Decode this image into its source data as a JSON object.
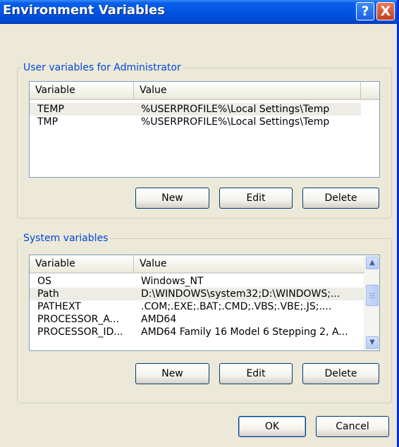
{
  "window": {
    "title": "Environment Variables",
    "help_label": "?",
    "close_label": "X",
    "title_bar_color": "#0055E5"
  },
  "user_vars": {
    "group_label": "User variables for Administrator",
    "columns": [
      "Variable",
      "Value"
    ],
    "rows": [
      {
        "variable": "TEMP",
        "value": "%USERPROFILE%\\Local Settings\\Temp"
      },
      {
        "variable": "TMP",
        "value": "%USERPROFILE%\\Local Settings\\Temp"
      }
    ],
    "selected_index": 0,
    "buttons": {
      "new": "New",
      "edit": "Edit",
      "delete": "Delete"
    }
  },
  "system_vars": {
    "group_label": "System variables",
    "columns": [
      "Variable",
      "Value"
    ],
    "rows": [
      {
        "variable": "OS",
        "value": "Windows_NT"
      },
      {
        "variable": "Path",
        "value": "D:\\WINDOWS\\system32;D:\\WINDOWS;..."
      },
      {
        "variable": "PATHEXT",
        "value": ".COM;.EXE;.BAT;.CMD;.VBS;.VBE;.JS;...."
      },
      {
        "variable": "PROCESSOR_A...",
        "value": "AMD64"
      },
      {
        "variable": "PROCESSOR_ID...",
        "value": "AMD64 Family 16 Model 6 Stepping 2, A..."
      }
    ],
    "selected_index": 1,
    "scrollbar": {
      "up_icon": "▲",
      "down_icon": "▼"
    },
    "buttons": {
      "new": "New",
      "edit": "Edit",
      "delete": "Delete"
    }
  },
  "dialog_buttons": {
    "ok": "OK",
    "cancel": "Cancel"
  }
}
